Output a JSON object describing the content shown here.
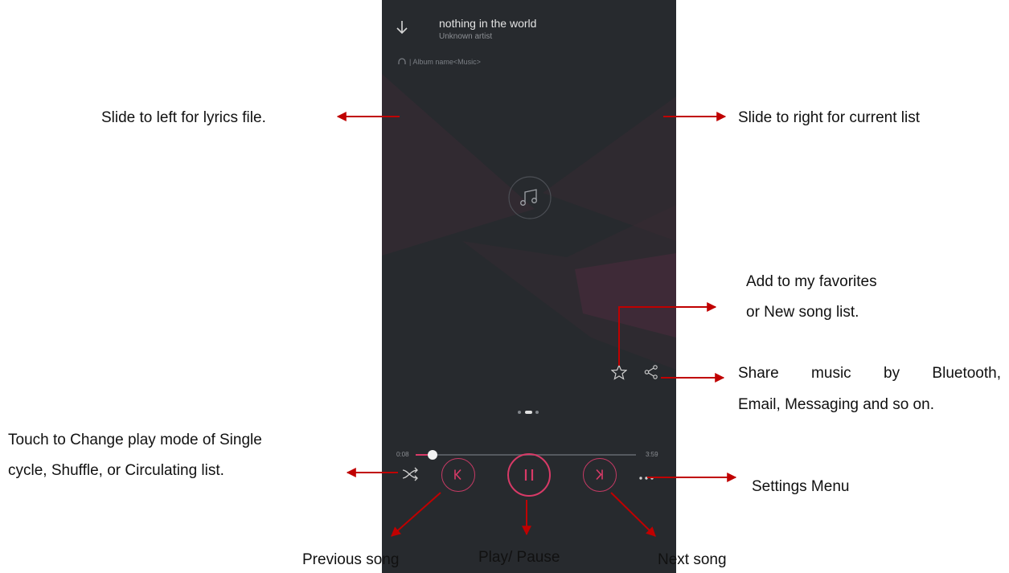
{
  "player": {
    "title": "nothing in the world",
    "artist": "Unknown artist",
    "album": "Album name<Music>",
    "album_separator": "|",
    "time_current": "0:08",
    "time_total": "3:59",
    "progress": 0.034,
    "page_dots": 3,
    "active_page_dot": 2
  },
  "annotations": {
    "lyrics": "Slide to left for lyrics file.",
    "current_list": "Slide to right for current list",
    "favorites_1": "Add to my favorites",
    "favorites_2": "or New song list.",
    "share_1": "Share music by Bluetooth,",
    "share_2": "Email, Messaging and so on.",
    "playmode_1": "Touch to Change play mode of Single",
    "playmode_2": "cycle, Shuffle, or Circulating list.",
    "settings": "Settings Menu",
    "previous": "Previous song",
    "play_pause": "Play/ Pause",
    "next": "Next song"
  },
  "icons": {
    "collapse": "arrow-down-icon",
    "headphones": "headphones-icon",
    "music_note": "music-note-icon",
    "favorite": "star-icon",
    "share": "share-icon",
    "shuffle": "shuffle-icon",
    "previous": "skip-previous-icon",
    "play_pause": "pause-icon",
    "next": "skip-next-icon",
    "more": "more-dots-icon"
  },
  "colors": {
    "phone_background": "#272a2e",
    "accent": "#d83a67",
    "arrow": "#c00000"
  }
}
